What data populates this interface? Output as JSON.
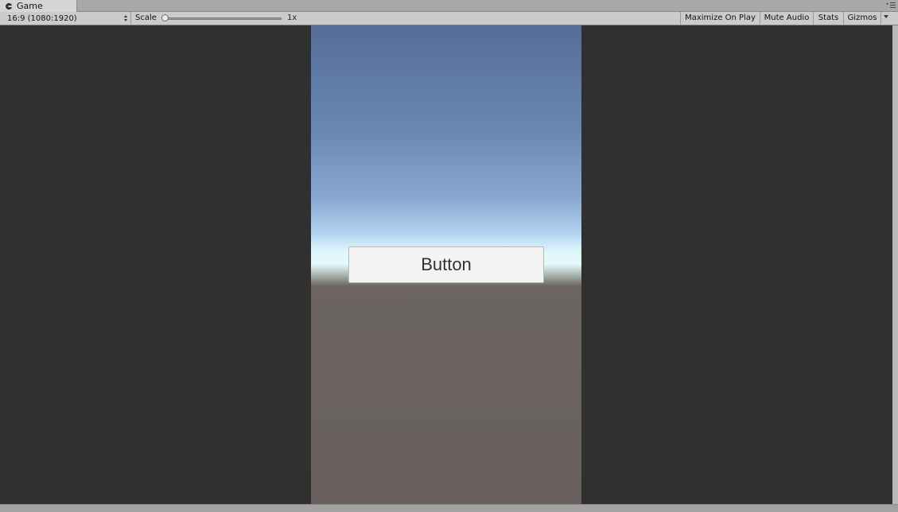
{
  "tab": {
    "label": "Game",
    "icon": "game-controller-icon"
  },
  "toolbar": {
    "aspect_label": "16:9 (1080:1920)",
    "scale_label": "Scale",
    "scale_value": "1x",
    "maximize_label": "Maximize On Play",
    "mute_label": "Mute Audio",
    "stats_label": "Stats",
    "gizmos_label": "Gizmos"
  },
  "game": {
    "button_label": "Button"
  },
  "colors": {
    "letterbox": "#303030",
    "sky_top": "#546e98",
    "horizon": "#e5fbfb",
    "ground": "#67605d",
    "toolbar": "#cbcbcb"
  }
}
